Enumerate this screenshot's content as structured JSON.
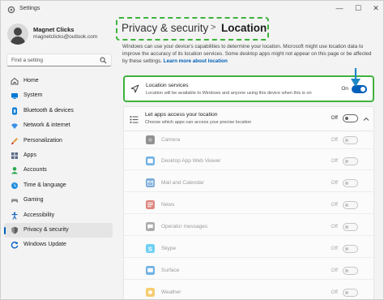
{
  "window": {
    "title": "Settings",
    "controls": [
      "—",
      "☐",
      "✕"
    ]
  },
  "profile": {
    "name": "Magnet Clicks",
    "email": "magnetclicks@outlook.com"
  },
  "search": {
    "placeholder": "Find a setting"
  },
  "sidebar": {
    "items": [
      {
        "label": "Home",
        "icon": "home-icon",
        "color": "#6b6b6b"
      },
      {
        "label": "System",
        "icon": "system-icon",
        "color": "#0078d4"
      },
      {
        "label": "Bluetooth & devices",
        "icon": "bluetooth-icon",
        "color": "#0078d4"
      },
      {
        "label": "Network & internet",
        "icon": "wifi-icon",
        "color": "#3a8ee6"
      },
      {
        "label": "Personalization",
        "icon": "brush-icon",
        "color": "#e39a3c"
      },
      {
        "label": "Apps",
        "icon": "apps-icon",
        "color": "#5b6d8a"
      },
      {
        "label": "Accounts",
        "icon": "accounts-icon",
        "color": "#2fa84f"
      },
      {
        "label": "Time & language",
        "icon": "time-language-icon",
        "color": "#1f8ce0"
      },
      {
        "label": "Gaming",
        "icon": "gaming-icon",
        "color": "#8a8a8a"
      },
      {
        "label": "Accessibility",
        "icon": "accessibility-icon",
        "color": "#1565c0"
      },
      {
        "label": "Privacy & security",
        "icon": "shield-icon",
        "color": "#7a7a7a",
        "active": true
      },
      {
        "label": "Windows Update",
        "icon": "windows-update-icon",
        "color": "#0a64c8"
      }
    ]
  },
  "header": {
    "parent": "Privacy & security",
    "separator": ">",
    "current": "Location"
  },
  "intro": {
    "text": "Windows can use your device's capabilities to determine your location. Microsoft might use location data to improve the accuracy of its location services. Some desktop apps might not appear on this page or be affected by these settings.",
    "link": "Learn more about location"
  },
  "location_services": {
    "title": "Location services",
    "description": "Location will be available to Windows and anyone using this device when this is on",
    "state": "On"
  },
  "apps_access": {
    "title": "Let apps access your location",
    "description": "Choose which apps can access your precise location",
    "state": "Off"
  },
  "apps": [
    {
      "name": "Camera",
      "state": "Off",
      "icon": "camera-app-icon",
      "color": "#3b3b3b"
    },
    {
      "name": "Desktop App Web Viewer",
      "state": "Off",
      "icon": "web-viewer-icon",
      "color": "#0078d4"
    },
    {
      "name": "Mail and Calendar",
      "state": "Off",
      "icon": "mail-calendar-icon",
      "color": "#0f6cbd"
    },
    {
      "name": "News",
      "state": "Off",
      "icon": "news-icon",
      "color": "#c42b1c"
    },
    {
      "name": "Operator messages",
      "state": "Off",
      "icon": "operator-messages-icon",
      "color": "#6b6b6b"
    },
    {
      "name": "Skype",
      "state": "Off",
      "icon": "skype-icon",
      "color": "#00aff0"
    },
    {
      "name": "Surface",
      "state": "Off",
      "icon": "surface-icon",
      "color": "#0078d4"
    },
    {
      "name": "Weather",
      "state": "Off",
      "icon": "weather-icon",
      "color": "#f2a900"
    }
  ],
  "colors": {
    "accent": "#005fb8",
    "callout": "#3fb23d",
    "arrow": "#1e88c7"
  }
}
